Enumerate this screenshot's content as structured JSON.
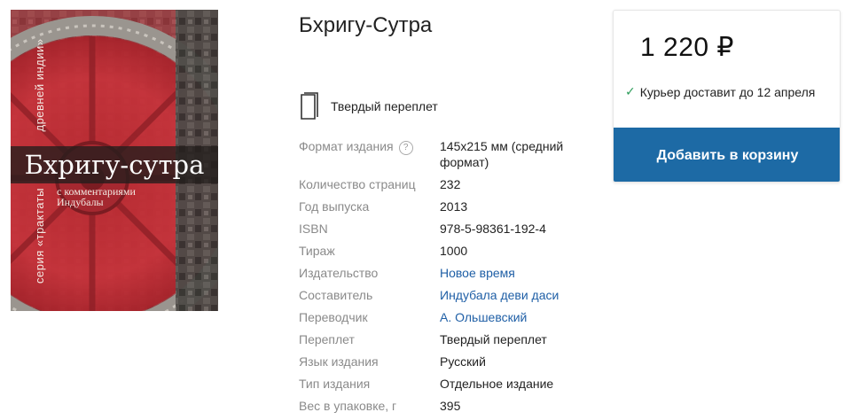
{
  "book": {
    "title": "Бхригу-Сутра",
    "cover": {
      "title": "Бхригу-сутра",
      "subtitle_line1": "с комментариями",
      "subtitle_line2": "Индубалы",
      "series_part1": "серия «трактаты",
      "series_part2": "древней индии»"
    },
    "binding_label": "Твердый переплет"
  },
  "specs": [
    {
      "label": "Формат издания",
      "value": "145x215 мм (средний формат)",
      "help": "?"
    },
    {
      "label": "Количество страниц",
      "value": "232"
    },
    {
      "label": "Год выпуска",
      "value": "2013"
    },
    {
      "label": "ISBN",
      "value": "978-5-98361-192-4"
    },
    {
      "label": "Тираж",
      "value": "1000"
    },
    {
      "label": "Издательство",
      "value": "Новое время",
      "link": true
    },
    {
      "label": "Составитель",
      "value": "Индубала деви даси",
      "link": true
    },
    {
      "label": "Переводчик",
      "value": "А. Ольшевский",
      "link": true
    },
    {
      "label": "Переплет",
      "value": "Твердый переплет"
    },
    {
      "label": "Язык издания",
      "value": "Русский"
    },
    {
      "label": "Тип издания",
      "value": "Отдельное издание"
    },
    {
      "label": "Вес в упаковке, г",
      "value": "395"
    }
  ],
  "purchase": {
    "price": "1 220 ₽",
    "delivery": "Курьер доставит до 12 апреля",
    "add_to_cart": "Добавить в корзину"
  },
  "colors": {
    "accent": "#1d6aa5",
    "link": "#1f5fa6",
    "check": "#2e9d5b",
    "cover_red": "#c8323a"
  },
  "icons": {
    "binding": "book-icon",
    "help": "help-icon",
    "delivery": "check-icon"
  }
}
